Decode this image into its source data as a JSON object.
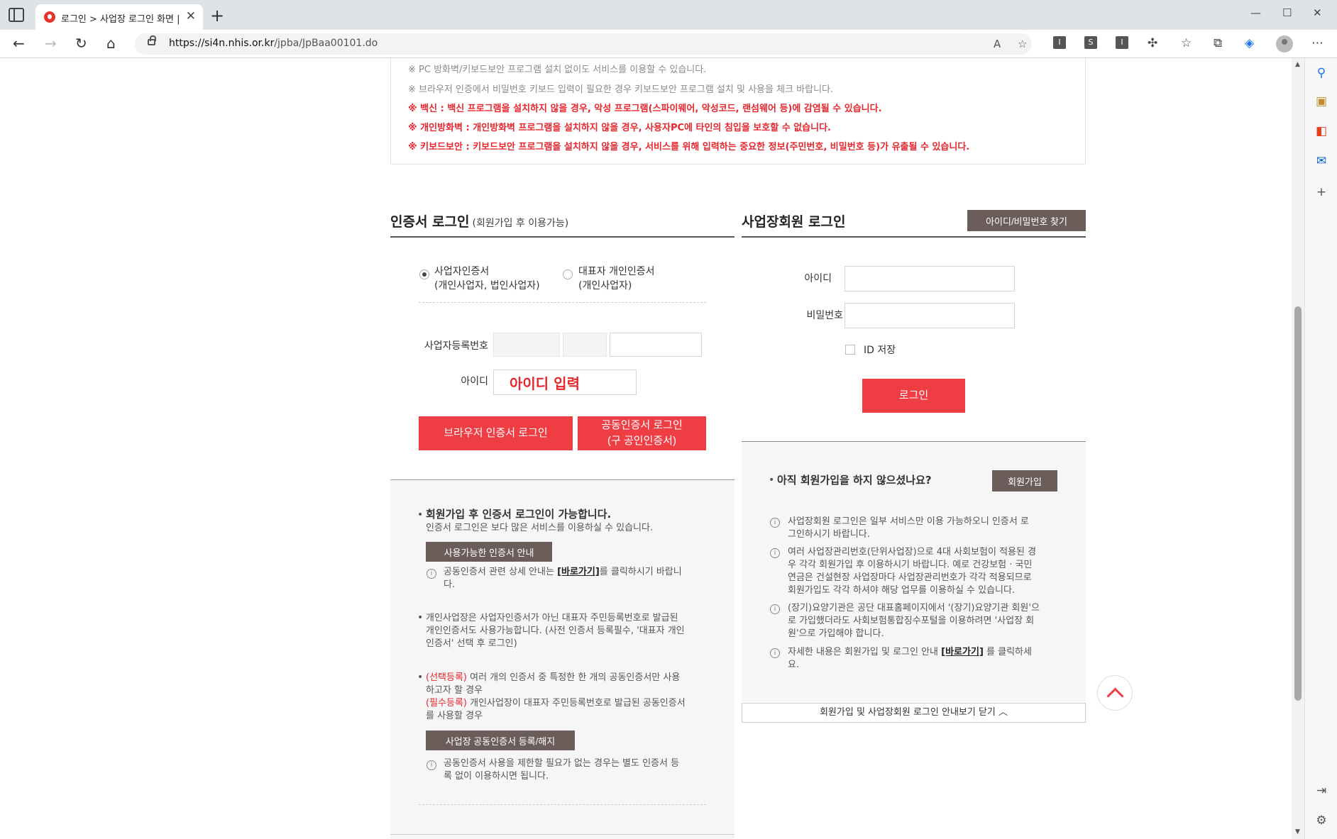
{
  "browser": {
    "tab_title": "로그인 > 사업장 로그인 화면 | h",
    "url_host": "https://si4n.nhis.or.kr",
    "url_path": "/jpba/JpBaa00101.do",
    "extensions": [
      "I",
      "S",
      "I"
    ]
  },
  "notices": {
    "lines": [
      {
        "text": "※ PC 방화벽/키보드보안 프로그램 설치 없이도 서비스를 이용할 수 있습니다.",
        "style": "gray"
      },
      {
        "text": "※ 브라우저 인증에서 비밀번호 키보드 입력이 필요한 경우 키보드보안 프로그램 설치 및 사용을 체크 바랍니다.",
        "style": "gray"
      },
      {
        "text": "※ 백신 : 백신 프로그램을 설치하지 않을 경우, 악성 프로그램(스파이웨어, 악성코드, 랜섬웨어 등)에 감염될 수 있습니다.",
        "style": "red"
      },
      {
        "text": "※ 개인방화벽 : 개인방화벽 프로그램을 설치하지 않을 경우, 사용자PC에 타인의 침입을 보호할 수 없습니다.",
        "style": "red"
      },
      {
        "text": "※ 키보드보안 : 키보드보안 프로그램을 설치하지 않을 경우, 서비스를 위해 입력하는 중요한 정보(주민번호, 비밀번호 등)가 유출될 수 있습니다.",
        "style": "red"
      }
    ]
  },
  "cert_login": {
    "title": "인증서 로그인",
    "title_note": "(회원가입 후 이용가능)",
    "radio1_line1": "사업자인증서",
    "radio1_line2": "(개인사업자, 법인사업자)",
    "radio2_line1": "대표자 개인인증서",
    "radio2_line2": "(개인사업자)",
    "selected": "사업자인증서",
    "biz_no_label": "사업자등록번호",
    "id_label": "아이디",
    "id_overlay": "아이디 입력",
    "browser_btn": "브라우저 인증서 로그인",
    "joint_btn_line1": "공동인증서 로그인",
    "joint_btn_line2": "(구 공인인증서)"
  },
  "cert_info": {
    "b1_title": "회원가입 후 인증서 로그인이 가능합니다.",
    "b1_text": "인증서 로그인은 보다 많은 서비스를 이용하실 수 있습니다.",
    "cert_guide_btn": "사용가능한 인증서 안내",
    "i1_text_a": "공동인증서 관련 상세 안내는 ",
    "i1_link": "[바로가기]",
    "i1_text_b": "를 클릭하시기 바랍니",
    "i1_text_c": "다.",
    "b2_line1": "개인사업장은 사업자인증서가 아닌 대표자 주민등록번호로 발급된",
    "b2_line2": "개인인증서도 사용가능합니다. (사전 인증서 등록필수, '대표자 개인",
    "b2_line3": "인증서' 선택 후 로그인)",
    "b3_tag1": "(선택등록)",
    "b3_line1": " 여러 개의 인증서 중 특정한 한 개의 공동인증서만 사용",
    "b3_line2": "하고자 할 경우",
    "b3_tag2": "(필수등록)",
    "b3_line3": " 개인사업장이 대표자 주민등록번호로 발급된 공동인증서",
    "b3_line4": "를 사용할 경우",
    "register_btn": "사업장 공동인증서 등록/해지",
    "i2_line1": "공동인증서 사용을 제한할 필요가 없는 경우는 별도 인증서 등",
    "i2_line2": "록 없이 이용하시면 됩니다."
  },
  "member_login": {
    "title": "사업장회원 로그인",
    "find_btn": "아이디/비밀번호 찾기",
    "id_label": "아이디",
    "pw_label": "비밀번호",
    "save_id_label": "ID 저장",
    "login_btn": "로그인"
  },
  "member_info": {
    "join_question": "아직 회원가입을 하지 않으셨나요?",
    "join_btn": "회원가입",
    "i1_line1": "사업장회원 로그인은 일부 서비스만 이용 가능하오니 인증서 로",
    "i1_line2": "그인하시기 바랍니다.",
    "i2_line1": "여러 사업장관리번호(단위사업장)으로 4대 사회보험이 적용된 경",
    "i2_line2": "우 각각 회원가입 후 이용하시기 바랍니다. 예로 건강보험 · 국민",
    "i2_line3": "연금은 건설현장 사업장마다 사업장관리번호가 각각 적용되므로",
    "i2_line4": "회원가입도 각각 하셔야 해당 업무를 이용하실 수 있습니다.",
    "i3_line1": "(장기)요양기관은 공단 대표홈페이지에서 '(장기)요양기관 회원'으",
    "i3_line2": "로 가입했더라도 사회보험통합징수포털을 이용하려면 '사업장 회",
    "i3_line3": "원'으로 가입해야 합니다.",
    "i4_text_a": "자세한 내용은 회원가입 및 로그인 안내 ",
    "i4_link": "[바로가기]",
    "i4_text_b": " 를 클릭하세",
    "i4_text_c": "요.",
    "guide_toggle": "회원가입 및 사업장회원 로그인 안내보기 닫기 ︿"
  },
  "colors": {
    "accent_red": "#ef3d44",
    "dark_button": "#6b5e5a",
    "notice_red": "#e8262d"
  }
}
